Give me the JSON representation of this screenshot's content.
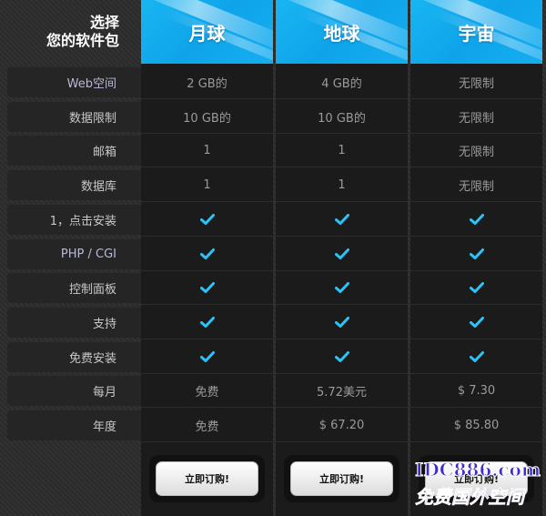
{
  "header": {
    "title_line1": "选择",
    "title_line2": "您的软件包"
  },
  "plans": [
    {
      "name": "月球",
      "button_label": "立即订购!"
    },
    {
      "name": "地球",
      "button_label": "立即订购!"
    },
    {
      "name": "宇宙",
      "button_label": "立即订购!"
    }
  ],
  "rows": [
    {
      "label": "Web空间",
      "values": [
        "2 GB的",
        "4 GB的",
        "无限制"
      ]
    },
    {
      "label": "数据限制",
      "values": [
        "10 GB的",
        "10 GB的",
        "无限制"
      ]
    },
    {
      "label": "邮箱",
      "values": [
        "1",
        "1",
        "无限制"
      ]
    },
    {
      "label": "数据库",
      "values": [
        "1",
        "1",
        "无限制"
      ]
    },
    {
      "label": "1，点击安装",
      "values": [
        "check",
        "check",
        "check"
      ]
    },
    {
      "label": "PHP / CGI",
      "values": [
        "check",
        "check",
        "check"
      ]
    },
    {
      "label": "控制面板",
      "values": [
        "check",
        "check",
        "check"
      ]
    },
    {
      "label": "支持",
      "values": [
        "check",
        "check",
        "check"
      ]
    },
    {
      "label": "免费安装",
      "values": [
        "check",
        "check",
        "check"
      ]
    },
    {
      "label": "每月",
      "values": [
        "免费",
        "5.72美元",
        "$ 7.30"
      ]
    },
    {
      "label": "年度",
      "values": [
        "免费",
        "$ 67.20",
        "$ 85.80"
      ]
    }
  ],
  "icons": {
    "check": "check-icon"
  },
  "colors": {
    "header_blue": "#15adf0",
    "check": "#2cc4f6"
  },
  "watermark": {
    "line1": "IDC886.com",
    "line2": "免费国外空间"
  }
}
